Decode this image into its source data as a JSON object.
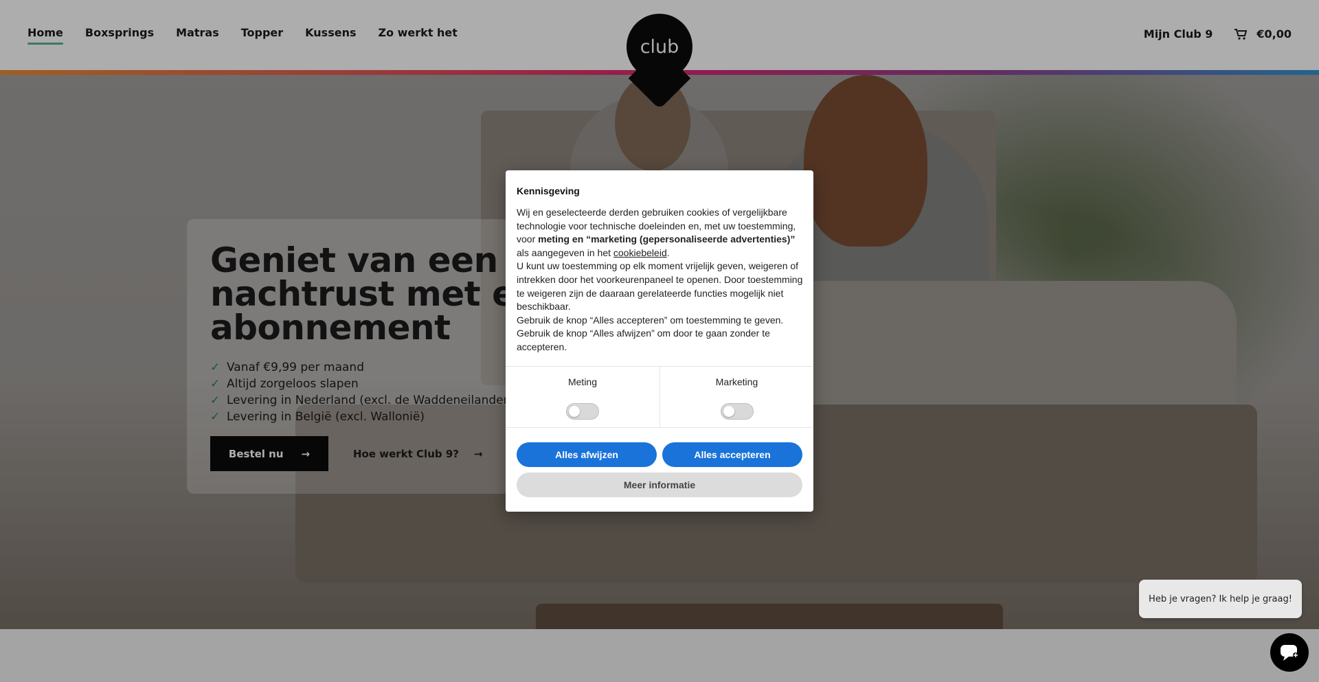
{
  "header": {
    "nav": [
      {
        "label": "Home",
        "active": true
      },
      {
        "label": "Boxsprings",
        "active": false
      },
      {
        "label": "Matras",
        "active": false
      },
      {
        "label": "Topper",
        "active": false
      },
      {
        "label": "Kussens",
        "active": false
      },
      {
        "label": "Zo werkt het",
        "active": false
      }
    ],
    "logo_text": "club",
    "account_label": "Mijn Club 9",
    "cart_total": "€0,00",
    "cart_icon": "cart-icon"
  },
  "hero": {
    "title": "Geniet van een goede nachtrust met een Club 9 abonnement",
    "usps": [
      "Vanaf €9,99 per maand",
      "Altijd zorgeloos slapen",
      "Levering in Nederland (excl. de Waddeneilanden)",
      "Levering in België (excl. Wallonië)"
    ],
    "order_button": "Bestel nu",
    "how_button": "Hoe werkt Club 9?",
    "usp_icon": "checkmark-icon",
    "arrow_icon": "arrow-right-icon"
  },
  "cookie_notice": {
    "title": "Kennisgeving",
    "p1_a": "Wij en geselecteerde derden gebruiken cookies of vergelijkbare technologie voor technische doeleinden en, met uw toestemming, voor ",
    "p1_bold": "meting en “marketing (gepersonaliseerde advertenties)”",
    "p1_b": " als aangegeven in het ",
    "p1_link": "cookiebeleid",
    "p1_end": ".",
    "p2": "U kunt uw toestemming op elk moment vrijelijk geven, weigeren of intrekken door het voorkeurenpaneel te openen. Door toestemming te weigeren zijn de daaraan gerelateerde functies mogelijk niet beschikbaar.",
    "p3": "Gebruik de knop “Alles accepteren” om toestemming te geven. Gebruik de knop “Alles afwijzen” om door te gaan zonder te accepteren.",
    "toggles": [
      {
        "label": "Meting",
        "enabled": false
      },
      {
        "label": "Marketing",
        "enabled": false
      }
    ],
    "reject_button": "Alles afwijzen",
    "accept_button": "Alles accepteren",
    "more_button": "Meer informatie"
  },
  "chat": {
    "bubble_text": "Heb je vragen? Ik help je graag!",
    "icon": "chat-icon"
  },
  "colors": {
    "accent_blue": "#1a73d9",
    "nav_underline": "#4caf87",
    "check_green": "#1f7a54"
  }
}
